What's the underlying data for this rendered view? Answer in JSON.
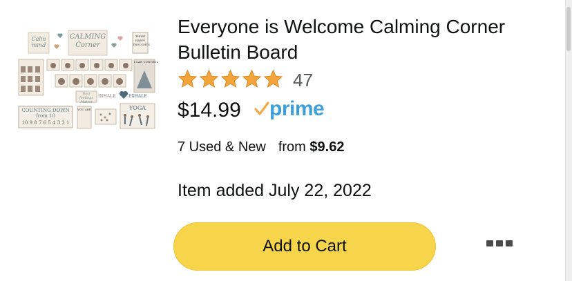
{
  "product": {
    "title": "Everyone is Welcome Calming Corner Bulletin Board",
    "rating": 5,
    "rating_count": "47",
    "price": "$14.99",
    "prime_label": "prime",
    "offers_label": "7 Used & New",
    "offers_from_label": "from",
    "offers_from_price": "$9.62",
    "added_date": "Item added July 22, 2022",
    "image_text": {
      "calm_mind": "Calm mind",
      "calming_corner": "CALMING Corner",
      "think": "THINK HAPPY THOUGHTS",
      "can_control": "I CAN CONTROL",
      "feelings": "Your feelings Matter",
      "inhale": "INHALE",
      "exhale": "EXHALE",
      "counting": "COUNTING DOWN from 10",
      "numbers": "10 9 8 7 6 5 4 3 2 1",
      "yoga": "YOGA",
      "you_are": "YOU ARE"
    }
  },
  "actions": {
    "add_to_cart_label": "Add to Cart",
    "more_icon": "ellipsis-icon"
  },
  "colors": {
    "star": "#f3a43a",
    "prime_blue": "#3e9fd9",
    "prime_check": "#f3a847",
    "button_yellow": "#f7d54a"
  }
}
